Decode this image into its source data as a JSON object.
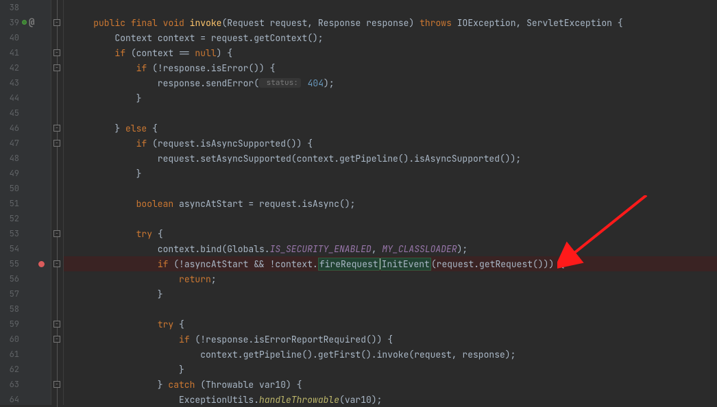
{
  "lines": [
    {
      "n": "38",
      "fold": "v",
      "code": [
        {
          "t": "",
          "c": ""
        }
      ]
    },
    {
      "n": "39",
      "vcs": true,
      "fold": "box",
      "code": [
        {
          "t": "    ",
          "c": ""
        },
        {
          "t": "public",
          "c": "kw"
        },
        {
          "t": " ",
          "c": ""
        },
        {
          "t": "final",
          "c": "kw"
        },
        {
          "t": " ",
          "c": ""
        },
        {
          "t": "void",
          "c": "kw"
        },
        {
          "t": " ",
          "c": ""
        },
        {
          "t": "invoke",
          "c": "method"
        },
        {
          "t": "(Request request, Response response)",
          "c": "ident"
        },
        {
          "t": " ",
          "c": ""
        },
        {
          "t": "throws",
          "c": "kw"
        },
        {
          "t": " IOException, ServletException {",
          "c": "ident"
        }
      ]
    },
    {
      "n": "40",
      "fold": "v",
      "code": [
        {
          "t": "        Context context = request.getContext();",
          "c": "ident"
        }
      ]
    },
    {
      "n": "41",
      "fold": "box",
      "code": [
        {
          "t": "        ",
          "c": ""
        },
        {
          "t": "if",
          "c": "kw"
        },
        {
          "t": " (context == ",
          "c": "ident"
        },
        {
          "t": "null",
          "c": "kw"
        },
        {
          "t": ") {",
          "c": "ident"
        }
      ]
    },
    {
      "n": "42",
      "fold": "box",
      "code": [
        {
          "t": "            ",
          "c": ""
        },
        {
          "t": "if",
          "c": "kw"
        },
        {
          "t": " (!response.isError()) {",
          "c": "ident"
        }
      ]
    },
    {
      "n": "43",
      "fold": "v",
      "code": [
        {
          "t": "                response.sendError(",
          "c": "ident"
        },
        {
          "t": " status:",
          "c": "param-hint"
        },
        {
          "t": " 404",
          "c": "num"
        },
        {
          "t": ");",
          "c": "ident"
        }
      ]
    },
    {
      "n": "44",
      "fold": "v",
      "code": [
        {
          "t": "            }",
          "c": "ident"
        }
      ]
    },
    {
      "n": "45",
      "fold": "v",
      "code": [
        {
          "t": "",
          "c": ""
        }
      ]
    },
    {
      "n": "46",
      "fold": "box",
      "code": [
        {
          "t": "        } ",
          "c": "ident"
        },
        {
          "t": "else",
          "c": "kw"
        },
        {
          "t": " {",
          "c": "ident"
        }
      ]
    },
    {
      "n": "47",
      "fold": "box",
      "code": [
        {
          "t": "            ",
          "c": ""
        },
        {
          "t": "if",
          "c": "kw"
        },
        {
          "t": " (request.isAsyncSupported()) {",
          "c": "ident"
        }
      ]
    },
    {
      "n": "48",
      "fold": "v",
      "code": [
        {
          "t": "                request.setAsyncSupported(context.getPipeline().isAsyncSupported());",
          "c": "ident"
        }
      ]
    },
    {
      "n": "49",
      "fold": "v",
      "code": [
        {
          "t": "            }",
          "c": "ident"
        }
      ]
    },
    {
      "n": "50",
      "fold": "v",
      "code": [
        {
          "t": "",
          "c": ""
        }
      ]
    },
    {
      "n": "51",
      "fold": "v",
      "code": [
        {
          "t": "            ",
          "c": ""
        },
        {
          "t": "boolean",
          "c": "kw"
        },
        {
          "t": " asyncAtStart = request.isAsync();",
          "c": "ident"
        }
      ]
    },
    {
      "n": "52",
      "fold": "v",
      "code": [
        {
          "t": "",
          "c": ""
        }
      ]
    },
    {
      "n": "53",
      "fold": "box",
      "code": [
        {
          "t": "            ",
          "c": ""
        },
        {
          "t": "try",
          "c": "kw"
        },
        {
          "t": " {",
          "c": "ident"
        }
      ]
    },
    {
      "n": "54",
      "fold": "v",
      "code": [
        {
          "t": "                context.bind(Globals.",
          "c": "ident"
        },
        {
          "t": "IS_SECURITY_ENABLED",
          "c": "const"
        },
        {
          "t": ", ",
          "c": "ident"
        },
        {
          "t": "MY_CLASSLOADER",
          "c": "const"
        },
        {
          "t": ");",
          "c": "ident"
        }
      ]
    },
    {
      "n": "55",
      "bp": true,
      "fold": "box",
      "code": [
        {
          "t": "                ",
          "c": ""
        },
        {
          "t": "if",
          "c": "kw"
        },
        {
          "t": " (!asyncAtStart && !context.",
          "c": "ident"
        },
        {
          "t": "fireRequest",
          "c": "hl-box"
        },
        {
          "t": "",
          "c": "cursor-caret"
        },
        {
          "t": "InitEvent",
          "c": "hl-box"
        },
        {
          "t": "(request.getRequest())) {",
          "c": "ident"
        }
      ]
    },
    {
      "n": "56",
      "fold": "v",
      "code": [
        {
          "t": "                    ",
          "c": ""
        },
        {
          "t": "return",
          "c": "kw"
        },
        {
          "t": ";",
          "c": "ident"
        }
      ]
    },
    {
      "n": "57",
      "fold": "v",
      "code": [
        {
          "t": "                }",
          "c": "ident"
        }
      ]
    },
    {
      "n": "58",
      "fold": "v",
      "code": [
        {
          "t": "",
          "c": ""
        }
      ]
    },
    {
      "n": "59",
      "fold": "box",
      "code": [
        {
          "t": "                ",
          "c": ""
        },
        {
          "t": "try",
          "c": "kw"
        },
        {
          "t": " {",
          "c": "ident"
        }
      ]
    },
    {
      "n": "60",
      "fold": "box",
      "code": [
        {
          "t": "                    ",
          "c": ""
        },
        {
          "t": "if",
          "c": "kw"
        },
        {
          "t": " (!response.isErrorReportRequired()) {",
          "c": "ident"
        }
      ]
    },
    {
      "n": "61",
      "fold": "v",
      "code": [
        {
          "t": "                        context.getPipeline().getFirst().invoke(request, response);",
          "c": "ident"
        }
      ]
    },
    {
      "n": "62",
      "fold": "v",
      "code": [
        {
          "t": "                    }",
          "c": "ident"
        }
      ]
    },
    {
      "n": "63",
      "fold": "box",
      "code": [
        {
          "t": "                } ",
          "c": "ident"
        },
        {
          "t": "catch",
          "c": "kw"
        },
        {
          "t": " (Throwable var10) {",
          "c": "ident"
        }
      ]
    },
    {
      "n": "64",
      "fold": "v",
      "code": [
        {
          "t": "                    ExceptionUtils.",
          "c": "ident"
        },
        {
          "t": "handleThrowable",
          "c": "static-m"
        },
        {
          "t": "(var10);",
          "c": "ident"
        }
      ]
    }
  ]
}
